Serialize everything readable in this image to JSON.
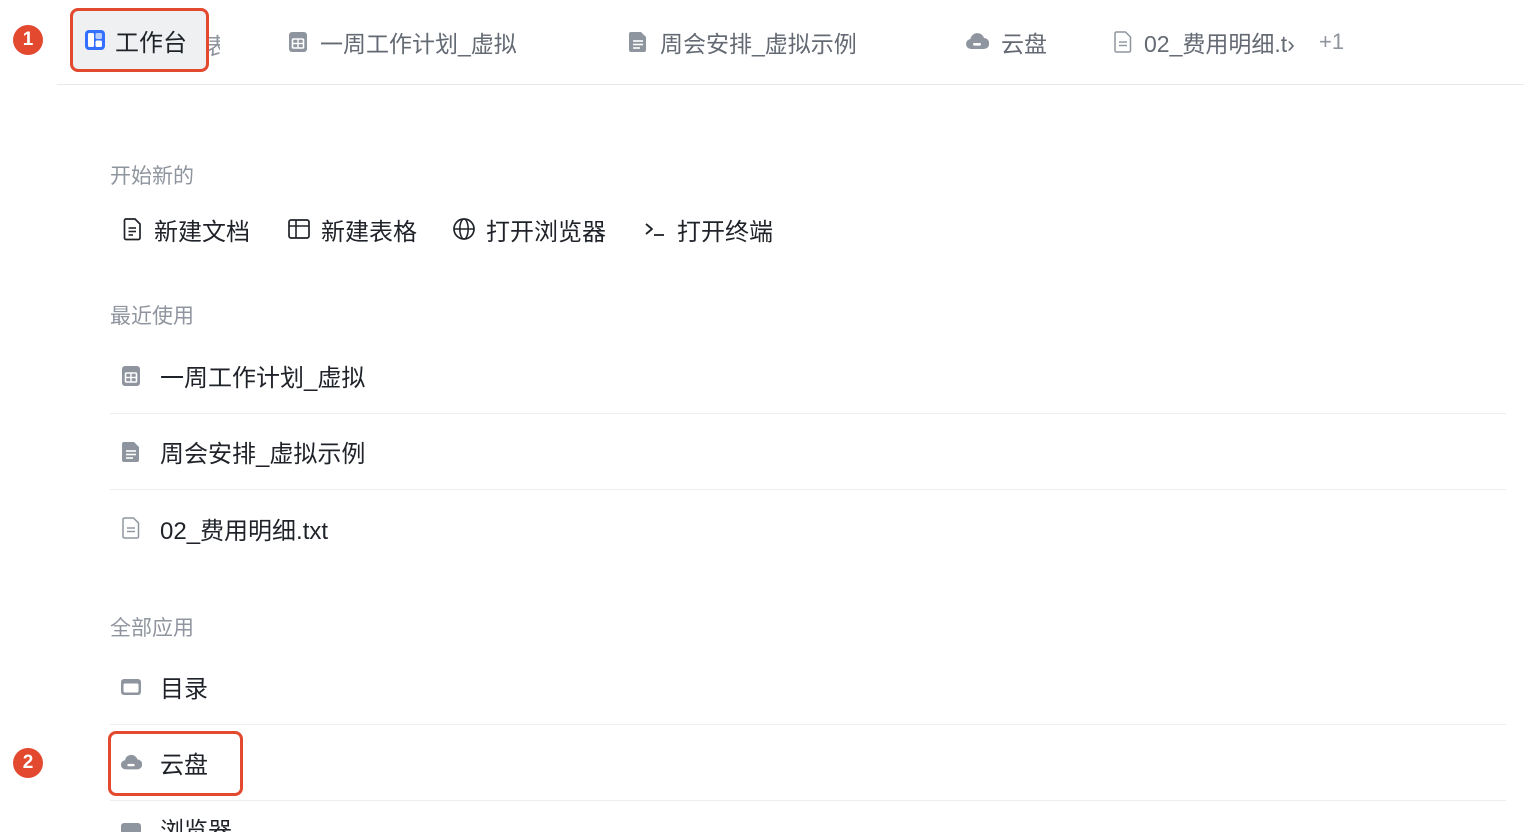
{
  "tabs": [
    {
      "label": "工作台",
      "icon": "workbench-icon",
      "active": true,
      "truncated_tail": "表"
    },
    {
      "label": "一周工作计划_虚拟",
      "icon": "sheet-icon"
    },
    {
      "label": "周会安排_虚拟示例",
      "icon": "doc-icon"
    },
    {
      "label": "云盘",
      "icon": "cloud-drive-icon"
    },
    {
      "label": "02_费用明细.t›",
      "icon": "text-file-icon"
    }
  ],
  "tab_overflow": "+1",
  "annotations": [
    "1",
    "2"
  ],
  "start_new": {
    "title": "开始新的",
    "actions": [
      {
        "label": "新建文档",
        "icon": "new-doc-icon"
      },
      {
        "label": "新建表格",
        "icon": "new-sheet-icon"
      },
      {
        "label": "打开浏览器",
        "icon": "globe-icon"
      },
      {
        "label": "打开终端",
        "icon": "terminal-icon"
      }
    ]
  },
  "recent": {
    "title": "最近使用",
    "items": [
      {
        "label": "一周工作计划_虚拟",
        "icon": "sheet-icon"
      },
      {
        "label": "周会安排_虚拟示例",
        "icon": "doc-icon"
      },
      {
        "label": "02_费用明细.txt",
        "icon": "text-file-icon"
      }
    ]
  },
  "apps": {
    "title": "全部应用",
    "items": [
      {
        "label": "目录",
        "icon": "folder-icon"
      },
      {
        "label": "云盘",
        "icon": "cloud-drive-icon"
      },
      {
        "label": "浏览器",
        "icon": "browser-icon"
      }
    ]
  },
  "colors": {
    "accent": "#e2492f",
    "text": "#1f2329",
    "muted": "#8f959e",
    "workbench_blue": "#3370ff"
  }
}
